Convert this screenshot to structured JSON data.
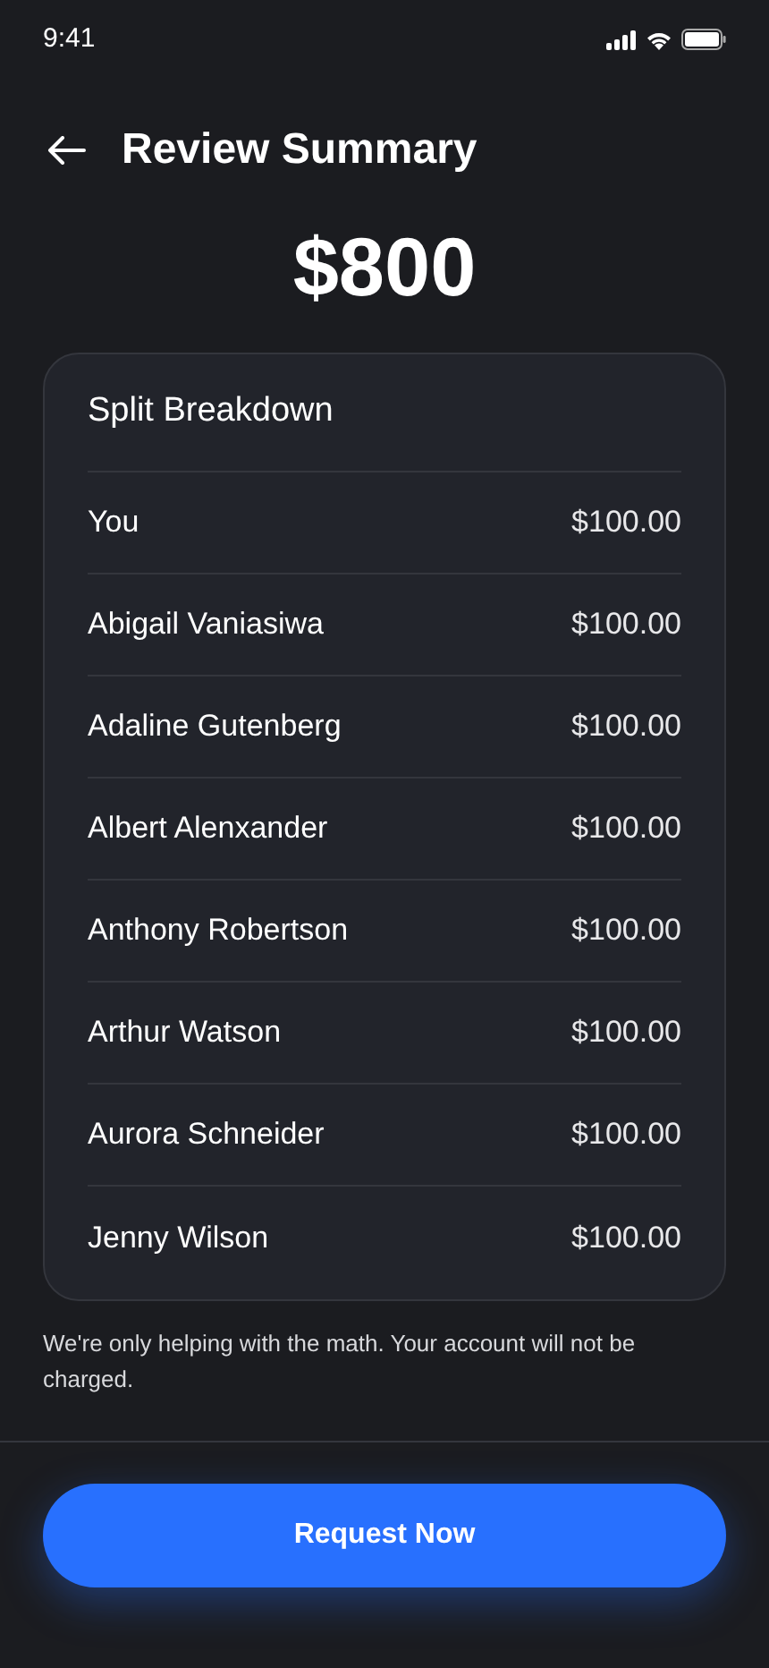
{
  "status_bar": {
    "time": "9:41"
  },
  "header": {
    "title": "Review Summary"
  },
  "total": "$800",
  "breakdown": {
    "title": "Split Breakdown",
    "rows": [
      {
        "name": "You",
        "amount": "$100.00"
      },
      {
        "name": "Abigail Vaniasiwa",
        "amount": "$100.00"
      },
      {
        "name": "Adaline Gutenberg",
        "amount": "$100.00"
      },
      {
        "name": "Albert Alenxander",
        "amount": "$100.00"
      },
      {
        "name": "Anthony Robertson",
        "amount": "$100.00"
      },
      {
        "name": "Arthur Watson",
        "amount": "$100.00"
      },
      {
        "name": "Aurora Schneider",
        "amount": "$100.00"
      },
      {
        "name": "Jenny Wilson",
        "amount": "$100.00"
      }
    ]
  },
  "note": "We're only helping with the math. Your account will not be charged.",
  "button": "Request Now"
}
